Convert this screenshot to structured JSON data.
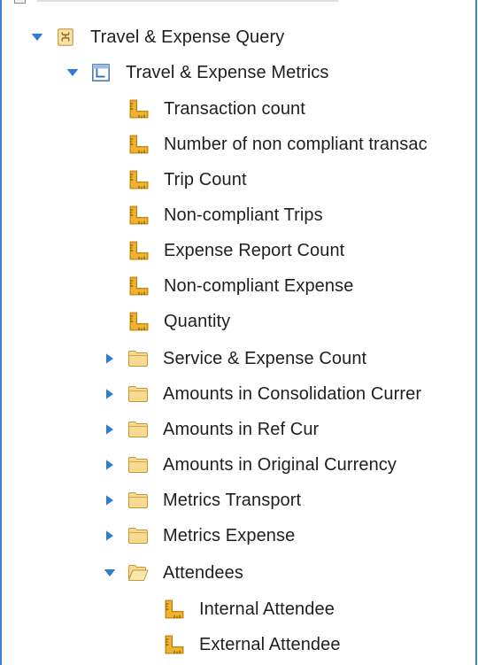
{
  "tree": {
    "query": {
      "label": "Travel & Expense Query",
      "icon": "query-icon",
      "expanded": true
    },
    "query_subject": {
      "label": "Travel & Expense Metrics",
      "icon": "query-subject-icon",
      "expanded": true
    },
    "measures": [
      {
        "label": "Transaction count",
        "icon": "measure-ruler-icon"
      },
      {
        "label": "Number of non compliant transac",
        "icon": "measure-ruler-icon"
      },
      {
        "label": "Trip Count",
        "icon": "measure-ruler-icon"
      },
      {
        "label": "Non-compliant Trips",
        "icon": "measure-ruler-icon"
      },
      {
        "label": "Expense Report Count",
        "icon": "measure-ruler-icon"
      },
      {
        "label": "Non-compliant Expense",
        "icon": "measure-ruler-icon"
      },
      {
        "label": "Quantity",
        "icon": "measure-ruler-icon"
      }
    ],
    "folders": [
      {
        "label": "Service & Expense Count",
        "icon": "folder-icon",
        "expanded": false
      },
      {
        "label": "Amounts in Consolidation Currer",
        "icon": "folder-icon",
        "expanded": false
      },
      {
        "label": "Amounts in Ref Cur",
        "icon": "folder-icon",
        "expanded": false
      },
      {
        "label": "Amounts in Original Currency",
        "icon": "folder-icon",
        "expanded": false
      },
      {
        "label": "Metrics Transport",
        "icon": "folder-icon",
        "expanded": false
      },
      {
        "label": "Metrics Expense",
        "icon": "folder-icon",
        "expanded": false
      }
    ],
    "attendees_folder": {
      "label": "Attendees",
      "icon": "folder-open-icon",
      "expanded": true
    },
    "attendees": [
      {
        "label": "Internal Attendee",
        "icon": "measure-ruler-icon"
      },
      {
        "label": "External Attendee",
        "icon": "measure-ruler-icon"
      }
    ]
  },
  "colors": {
    "accent": "#3d80d6",
    "twisty": "#2f7bd5",
    "measure": "#e8a317",
    "folder": "#f2c66e",
    "text": "#1f1f1f"
  }
}
